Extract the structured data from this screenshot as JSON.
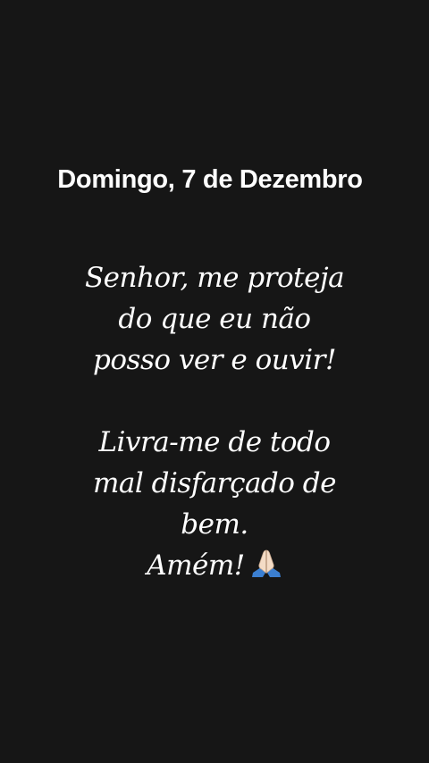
{
  "story": {
    "date_title": "Domingo, 7 de Dezembro",
    "prayer": {
      "lines": [
        "Senhor, me proteja",
        "do que eu não",
        "posso ver e ouvir!",
        "",
        "Livra-me de todo",
        "mal disfarçado de",
        "bem.",
        "Amém!"
      ],
      "closing_emoji": "praying-hands-icon"
    }
  },
  "colors": {
    "background": "#161616",
    "text": "#ffffff",
    "emoji_skin": "#f4dcc6",
    "emoji_sleeve": "#3b7fd1"
  }
}
